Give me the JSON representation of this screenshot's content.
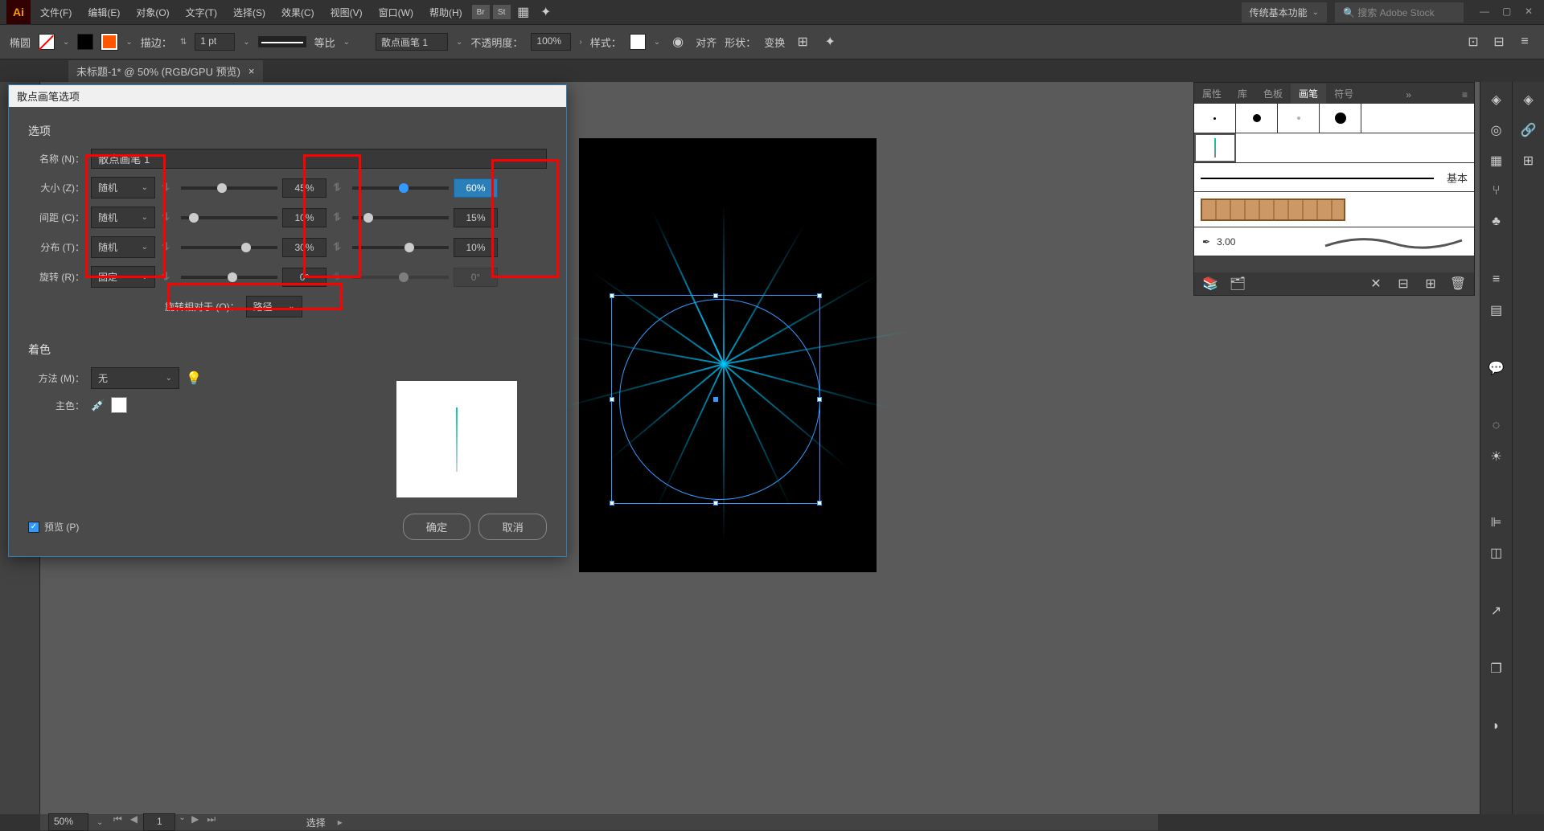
{
  "app": {
    "logo": "Ai"
  },
  "menu": {
    "file": "文件(F)",
    "edit": "编辑(E)",
    "object": "对象(O)",
    "type": "文字(T)",
    "select": "选择(S)",
    "effect": "效果(C)",
    "view": "视图(V)",
    "window": "窗口(W)",
    "help": "帮助(H)"
  },
  "menubar_right": {
    "workspace": "传统基本功能",
    "search_placeholder": "搜索 Adobe Stock"
  },
  "controlbar": {
    "tool": "椭圆",
    "stroke_label": "描边：",
    "stroke_weight": "1 pt",
    "profile": "等比",
    "brush": "散点画笔 1",
    "opacity_label": "不透明度：",
    "opacity": "100%",
    "style_label": "样式：",
    "align_label": "对齐",
    "shape_label": "形状：",
    "transform_label": "变换"
  },
  "doctab": {
    "title": "未标题-1* @ 50% (RGB/GPU 预览)"
  },
  "dialog": {
    "title": "散点画笔选项",
    "section_options": "选项",
    "name_label": "名称 (N)：",
    "name_value": "散点画笔 1",
    "size_label": "大小 (Z)：",
    "size_mode": "随机",
    "size_val1": "45%",
    "size_val2": "60%",
    "spacing_label": "间距 (C)：",
    "spacing_mode": "随机",
    "spacing_val1": "10%",
    "spacing_val2": "15%",
    "scatter_label": "分布 (T)：",
    "scatter_mode": "随机",
    "scatter_val1": "30%",
    "scatter_val2": "10%",
    "rotation_label": "旋转 (R)：",
    "rotation_mode": "固定",
    "rotation_val1": "0°",
    "rotation_val2": "0°",
    "rotation_relative_label": "旋转相对于 (O)：",
    "rotation_relative": "路径",
    "section_coloring": "着色",
    "method_label": "方法 (M)：",
    "method_value": "无",
    "keycolor_label": "主色：",
    "preview_label": "预览 (P)",
    "ok": "确定",
    "cancel": "取消"
  },
  "brushes_panel": {
    "tabs": {
      "properties": "属性",
      "libraries": "库",
      "swatches": "色板",
      "brushes": "画笔",
      "symbols": "符号"
    },
    "more": "»",
    "basic_label": "基本",
    "cal_size": "3.00"
  },
  "statusbar": {
    "zoom": "50%",
    "page": "1",
    "tool": "选择"
  }
}
